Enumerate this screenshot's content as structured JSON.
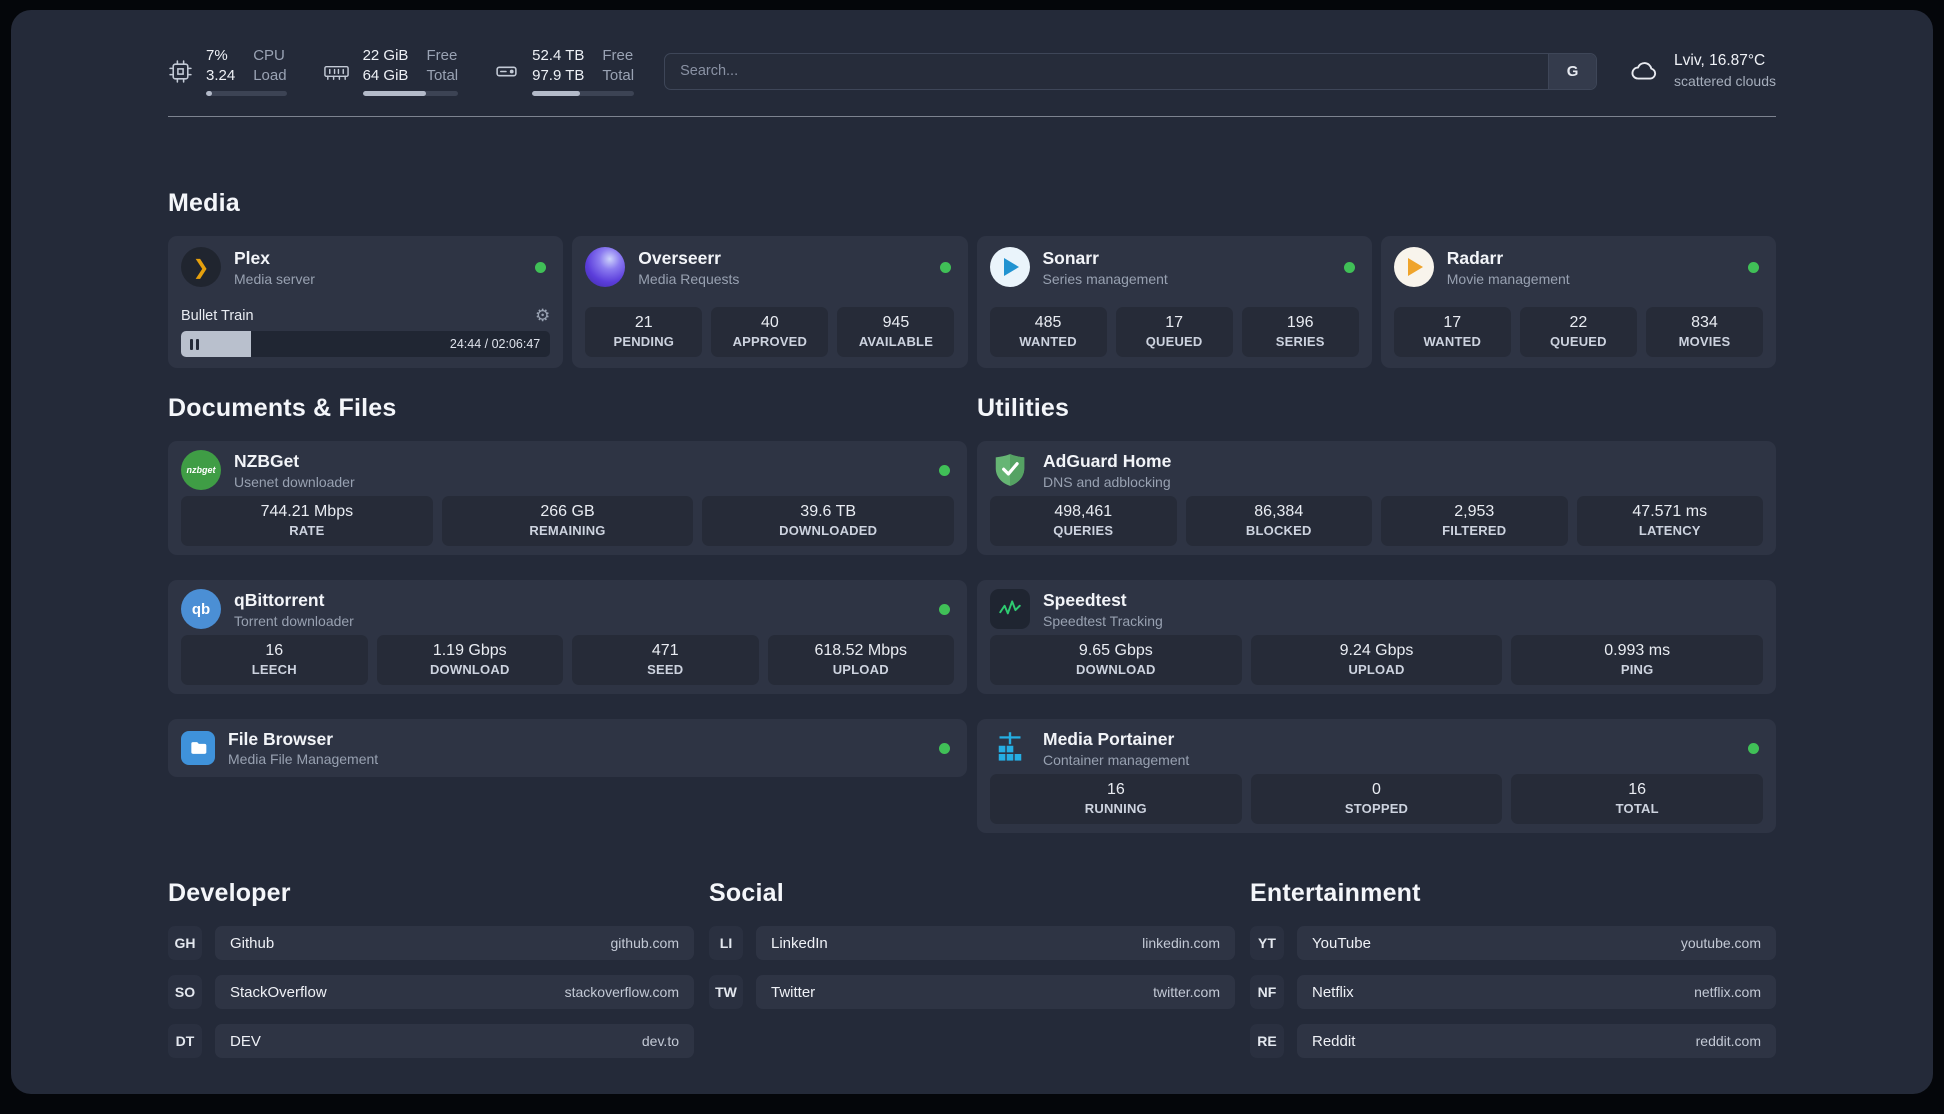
{
  "topbar": {
    "cpu": {
      "value_top": "7%",
      "value_bottom": "3.24",
      "label_top": "CPU",
      "label_bottom": "Load",
      "progress_pct": 7
    },
    "ram": {
      "value_top": "22 GiB",
      "value_bottom": "64 GiB",
      "label_top": "Free",
      "label_bottom": "Total",
      "progress_pct": 66
    },
    "disk": {
      "value_top": "52.4 TB",
      "value_bottom": "97.9 TB",
      "label_top": "Free",
      "label_bottom": "Total",
      "progress_pct": 47
    },
    "search": {
      "placeholder": "Search...",
      "engine": "G"
    },
    "weather": {
      "location": "Lviv, 16.87°C",
      "condition": "scattered clouds"
    }
  },
  "icons": {
    "gear": "⚙",
    "plex_chevron": "❯"
  },
  "media": {
    "title": "Media",
    "plex": {
      "name": "Plex",
      "subtitle": "Media server",
      "now_playing": "Bullet Train",
      "time": "24:44 / 02:06:47",
      "progress_pct": 19
    },
    "overseerr": {
      "name": "Overseerr",
      "subtitle": "Media Requests",
      "stats": [
        {
          "value": "21",
          "label": "PENDING"
        },
        {
          "value": "40",
          "label": "APPROVED"
        },
        {
          "value": "945",
          "label": "AVAILABLE"
        }
      ]
    },
    "sonarr": {
      "name": "Sonarr",
      "subtitle": "Series management",
      "stats": [
        {
          "value": "485",
          "label": "WANTED"
        },
        {
          "value": "17",
          "label": "QUEUED"
        },
        {
          "value": "196",
          "label": "SERIES"
        }
      ]
    },
    "radarr": {
      "name": "Radarr",
      "subtitle": "Movie management",
      "stats": [
        {
          "value": "17",
          "label": "WANTED"
        },
        {
          "value": "22",
          "label": "QUEUED"
        },
        {
          "value": "834",
          "label": "MOVIES"
        }
      ]
    }
  },
  "documents": {
    "title": "Documents & Files",
    "nzbget": {
      "name": "NZBGet",
      "subtitle": "Usenet downloader",
      "icon_text": "nzbget",
      "stats": [
        {
          "value": "744.21 Mbps",
          "label": "RATE"
        },
        {
          "value": "266 GB",
          "label": "REMAINING"
        },
        {
          "value": "39.6 TB",
          "label": "DOWNLOADED"
        }
      ]
    },
    "qbittorrent": {
      "name": "qBittorrent",
      "subtitle": "Torrent downloader",
      "icon_text": "qb",
      "stats": [
        {
          "value": "16",
          "label": "LEECH"
        },
        {
          "value": "1.19 Gbps",
          "label": "DOWNLOAD"
        },
        {
          "value": "471",
          "label": "SEED"
        },
        {
          "value": "618.52 Mbps",
          "label": "UPLOAD"
        }
      ]
    },
    "filebrowser": {
      "name": "File Browser",
      "subtitle": "Media File Management"
    }
  },
  "utilities": {
    "title": "Utilities",
    "adguard": {
      "name": "AdGuard Home",
      "subtitle": "DNS and adblocking",
      "stats": [
        {
          "value": "498,461",
          "label": "QUERIES"
        },
        {
          "value": "86,384",
          "label": "BLOCKED"
        },
        {
          "value": "2,953",
          "label": "FILTERED"
        },
        {
          "value": "47.571 ms",
          "label": "LATENCY"
        }
      ]
    },
    "speedtest": {
      "name": "Speedtest",
      "subtitle": "Speedtest Tracking",
      "stats": [
        {
          "value": "9.65 Gbps",
          "label": "DOWNLOAD"
        },
        {
          "value": "9.24 Gbps",
          "label": "UPLOAD"
        },
        {
          "value": "0.993 ms",
          "label": "PING"
        }
      ]
    },
    "portainer": {
      "name": "Media Portainer",
      "subtitle": "Container management",
      "stats": [
        {
          "value": "16",
          "label": "RUNNING"
        },
        {
          "value": "0",
          "label": "STOPPED"
        },
        {
          "value": "16",
          "label": "TOTAL"
        }
      ]
    }
  },
  "bookmarks": {
    "developer": {
      "title": "Developer",
      "items": [
        {
          "abbr": "GH",
          "name": "Github",
          "url": "github.com"
        },
        {
          "abbr": "SO",
          "name": "StackOverflow",
          "url": "stackoverflow.com"
        },
        {
          "abbr": "DT",
          "name": "DEV",
          "url": "dev.to"
        }
      ]
    },
    "social": {
      "title": "Social",
      "items": [
        {
          "abbr": "LI",
          "name": "LinkedIn",
          "url": "linkedin.com"
        },
        {
          "abbr": "TW",
          "name": "Twitter",
          "url": "twitter.com"
        }
      ]
    },
    "entertainment": {
      "title": "Entertainment",
      "items": [
        {
          "abbr": "YT",
          "name": "YouTube",
          "url": "youtube.com"
        },
        {
          "abbr": "NF",
          "name": "Netflix",
          "url": "netflix.com"
        },
        {
          "abbr": "RE",
          "name": "Reddit",
          "url": "reddit.com"
        }
      ]
    }
  },
  "colors": {
    "status_online": "#40c057",
    "accent_plex": "#e5a00d"
  }
}
